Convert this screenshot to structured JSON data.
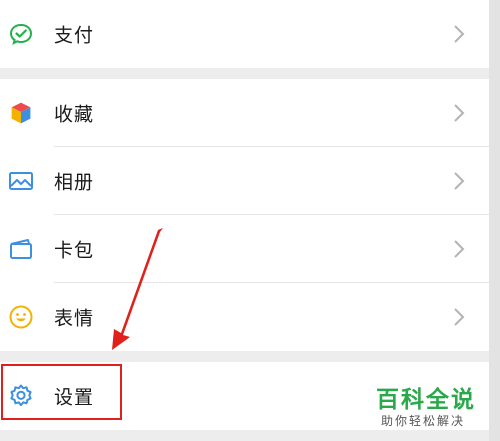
{
  "menu": {
    "pay": {
      "label": "支付",
      "icon": "wechat-pay-icon",
      "color": "#22b14c"
    },
    "favorites": {
      "label": "收藏",
      "icon": "cube-icon"
    },
    "album": {
      "label": "相册",
      "icon": "image-icon",
      "color": "#3d8fe0"
    },
    "cards": {
      "label": "卡包",
      "icon": "card-wallet-icon",
      "color": "#3d8fe0"
    },
    "stickers": {
      "label": "表情",
      "icon": "smiley-icon",
      "color": "#f3b100"
    },
    "settings": {
      "label": "设置",
      "icon": "gear-icon",
      "color": "#3d8fe0"
    }
  },
  "annotation": {
    "color": "#e0201b"
  },
  "watermark": {
    "title": "百科全说",
    "subtitle": "助你轻松解决",
    "color": "#2aa94a"
  }
}
